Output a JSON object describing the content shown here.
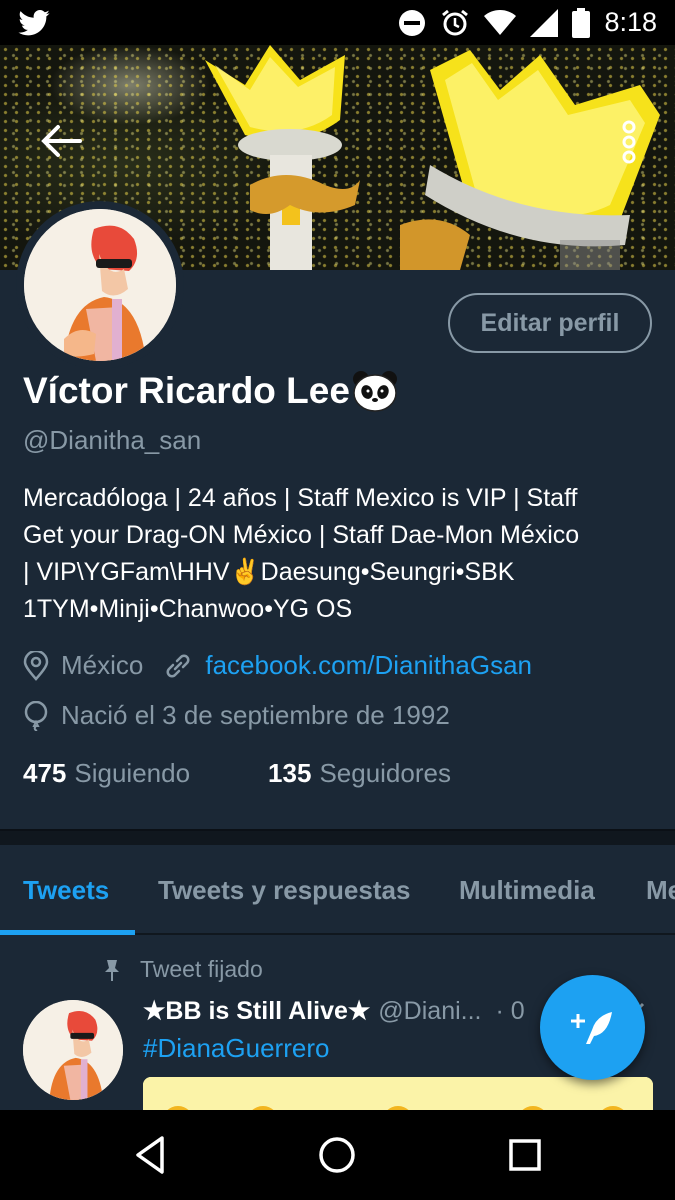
{
  "status_bar": {
    "time": "8:18",
    "icons": [
      "twitter-bird-icon",
      "dnd-icon",
      "alarm-icon",
      "wifi-icon",
      "signal-icon",
      "battery-icon"
    ]
  },
  "header": {
    "back_icon": "arrow-left-icon",
    "more_icon": "more-vertical-icon"
  },
  "profile": {
    "edit_label": "Editar perfil",
    "name": "Víctor Ricardo Lee",
    "name_emoji": "panda-emoji",
    "handle": "@Dianitha_san",
    "bio_lines": [
      "Mercadóloga | 24 años | Staff Mexico is VIP | Staff",
      "Get your Drag-ON México | Staff Dae-Mon México",
      "| VIP\\YGFam\\HHV✌Daesung•Seungri•SBK",
      "1TYM•Minji•Chanwoo•YG OS"
    ],
    "location": "México",
    "website": "facebook.com/DianithaGsan",
    "birthday": "Nació el 3 de septiembre de 1992",
    "following_count": "475",
    "following_label": "Siguiendo",
    "followers_count": "135",
    "followers_label": "Seguidores"
  },
  "tabs": [
    {
      "label": "Tweets",
      "active": true
    },
    {
      "label": "Tweets y respuestas",
      "active": false
    },
    {
      "label": "Multimedia",
      "active": false
    },
    {
      "label": "Me",
      "active": false
    }
  ],
  "tweet": {
    "pinned_label": "Tweet fijado",
    "author": "★BB is Still Alive★",
    "handle": "@Diani...",
    "time_prefix": "· 0",
    "hashtag": "#DianaGuerrero"
  },
  "compose": {
    "icon": "compose-feather-icon"
  },
  "nav": {
    "icons": [
      "back-triangle-icon",
      "home-circle-icon",
      "recents-square-icon"
    ]
  },
  "colors": {
    "background": "#1b2836",
    "accent": "#1da1f2",
    "muted": "#8899a6"
  }
}
